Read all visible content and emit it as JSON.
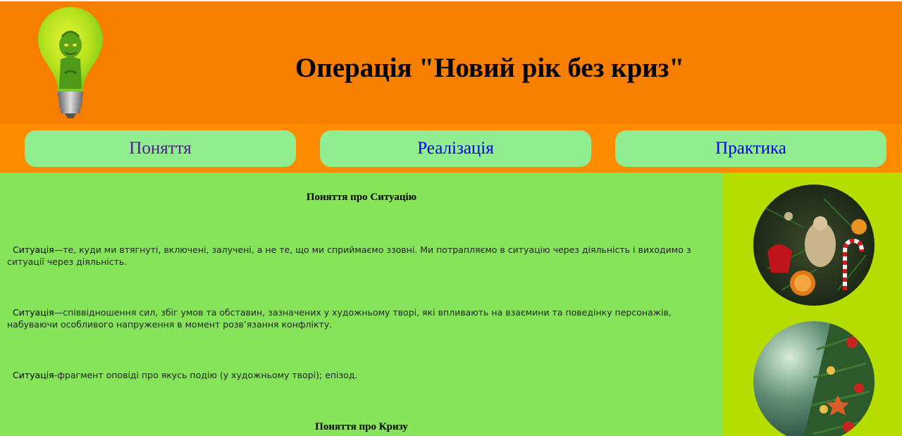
{
  "header": {
    "title": "Операція \"Новий рік без криз\""
  },
  "nav": {
    "items": [
      {
        "label": "Поняття"
      },
      {
        "label": "Реалізація"
      },
      {
        "label": "Практика"
      }
    ]
  },
  "main": {
    "section1_title": "Поняття про Ситуацію",
    "paragraphs": [
      {
        "term": "Ситуація",
        "text": "—те, куди ми втягнуті, включені, залучені, а не те, що ми сприймаємо ззовні. Ми потрапляємо в ситуацію через діяльність і виходимо з ситуації через діяльність."
      },
      {
        "term": "Ситуація",
        "text": "—співвідношення сил, збіг умов та обставин, зазначених у художньому творі, які впливають на взаємини та поведінку персонажів, набуваючи особливого напруження в момент розв’язання конфлікту."
      },
      {
        "term": "Ситуація",
        "text": "-фрагмент оповіді про якусь подію (у художньому творі); епізод."
      }
    ],
    "section2_title": "Поняття про Кризу"
  },
  "colors": {
    "header_bg": "#f77f00",
    "nav_bg": "#ff8c00",
    "nav_button_bg": "#90ee90",
    "main_bg": "#86e45b",
    "sidebar_bg": "#b5de00"
  }
}
